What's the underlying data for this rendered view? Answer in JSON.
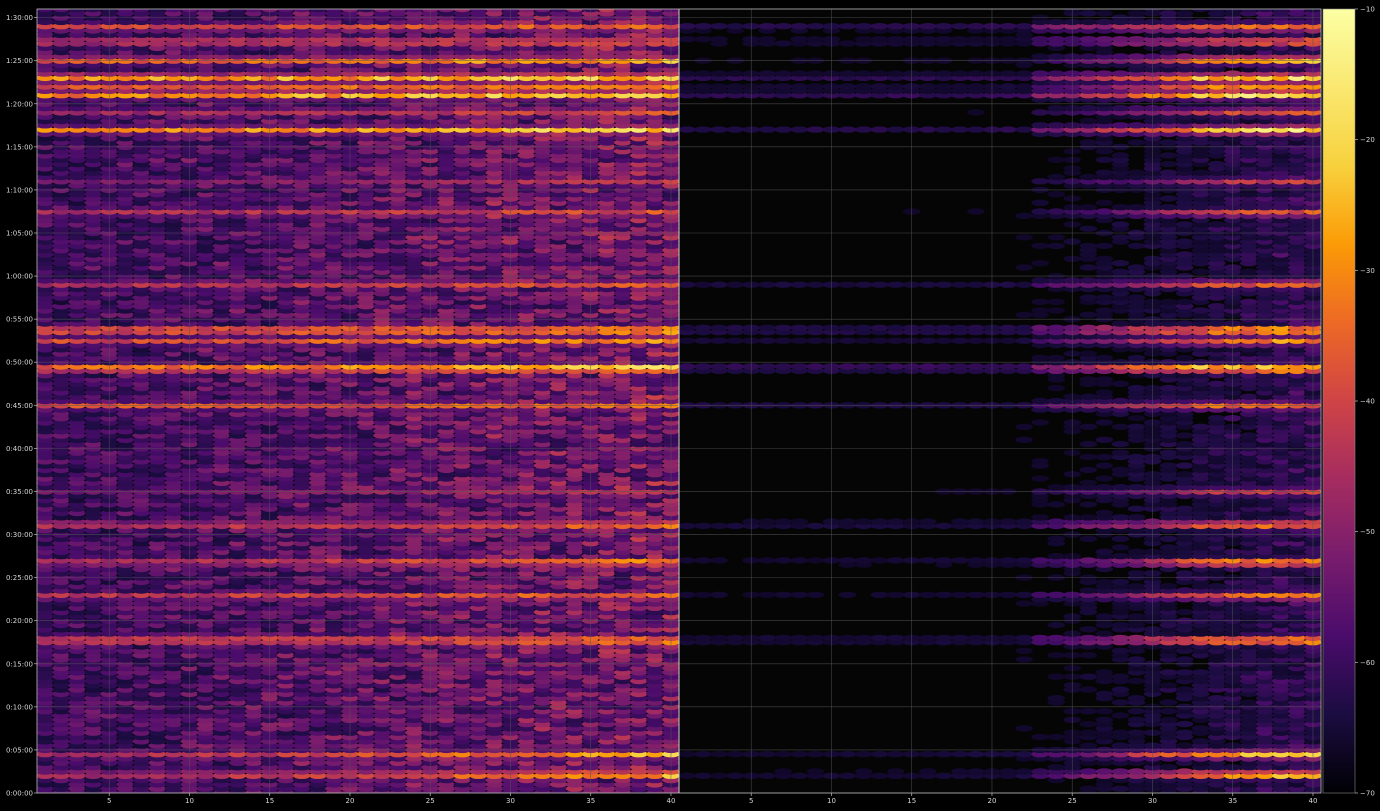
{
  "chart_data": {
    "type": "heatmap",
    "title": "",
    "xlabel": "",
    "ylabel": "",
    "grid": true,
    "colormap": "inferno",
    "background": "#000000",
    "grid_color": "#444444",
    "panels": [
      {
        "name": "",
        "xlim": [
          1,
          40
        ],
        "x_ticks": [
          5,
          10,
          15,
          20,
          25,
          30,
          35,
          40
        ],
        "x_tick_labels": [
          "5",
          "10",
          "15",
          "20",
          "25",
          "30",
          "35",
          "40"
        ]
      },
      {
        "name": "",
        "xlim": [
          1,
          40
        ],
        "x_ticks": [
          5,
          10,
          15,
          20,
          25,
          30,
          35,
          40
        ],
        "x_tick_labels": [
          "5",
          "10",
          "15",
          "20",
          "25",
          "30",
          "35",
          "40"
        ]
      }
    ],
    "y_range_seconds": [
      0,
      5460
    ],
    "y_ticks_seconds": [
      0,
      300,
      600,
      900,
      1200,
      1500,
      1800,
      2100,
      2400,
      2700,
      3000,
      3300,
      3600,
      3900,
      4200,
      4500,
      4800,
      5100,
      5400
    ],
    "y_tick_labels": [
      "0:00:00",
      "0:05:00",
      "0:10:00",
      "0:15:00",
      "0:20:00",
      "0:25:00",
      "0:30:00",
      "0:35:00",
      "0:40:00",
      "0:45:00",
      "0:50:00",
      "0:55:00",
      "1:00:00",
      "1:05:00",
      "1:10:00",
      "1:15:00",
      "1:20:00",
      "1:25:00",
      "1:30:00"
    ],
    "colorbar": {
      "range": [
        -70,
        -10
      ],
      "ticks": [
        -70,
        -60,
        -50,
        -40,
        -30,
        -20,
        -10
      ],
      "tick_labels": [
        "−70",
        "−60",
        "−50",
        "−40",
        "−30",
        "−20",
        "−10"
      ]
    },
    "bands": [
      {
        "t": 5335,
        "level": [
          0.5,
          0.62
        ],
        "span": [
          1,
          40
        ],
        "p2": 0.35
      },
      {
        "t": 5235,
        "level": [
          0.48,
          0.62
        ],
        "span": [
          1,
          40
        ],
        "p2": 0.25
      },
      {
        "t": 5105,
        "level": [
          0.58,
          0.78
        ],
        "span": [
          1,
          40
        ],
        "p2": 0.15
      },
      {
        "t": 4985,
        "level": [
          0.7,
          0.86
        ],
        "span": [
          1,
          40
        ],
        "p2": 0.28
      },
      {
        "t": 4925,
        "level": [
          0.55,
          0.76
        ],
        "span": [
          1,
          40
        ],
        "p2": 0.2
      },
      {
        "t": 4865,
        "level": [
          0.68,
          0.9
        ],
        "span": [
          1,
          40
        ],
        "p2": 0.3
      },
      {
        "t": 4745,
        "level": [
          0.4,
          0.56
        ],
        "span": [
          1,
          40
        ],
        "p2": 0.18
      },
      {
        "t": 4620,
        "level": [
          0.64,
          0.88
        ],
        "span": [
          1,
          40
        ],
        "p2": 0.26
      },
      {
        "t": 4260,
        "level": [
          0.3,
          0.48
        ],
        "span": [
          1,
          40
        ],
        "p2": 0.2
      },
      {
        "t": 4045,
        "level": [
          0.42,
          0.56
        ],
        "span": [
          1,
          40
        ],
        "p2": 0.18
      },
      {
        "t": 3545,
        "level": [
          0.44,
          0.58
        ],
        "span": [
          1,
          40
        ],
        "p2": 0.3
      },
      {
        "t": 3225,
        "level": [
          0.62,
          0.82
        ],
        "span": [
          1,
          40
        ],
        "p2": 0.3
      },
      {
        "t": 3150,
        "level": [
          0.52,
          0.7
        ],
        "span": [
          1,
          40
        ],
        "p2": 0.22
      },
      {
        "t": 2960,
        "level": [
          0.66,
          0.9
        ],
        "span": [
          1,
          40
        ],
        "p2": 0.35
      },
      {
        "t": 2700,
        "level": [
          0.54,
          0.62
        ],
        "span": [
          1,
          40
        ],
        "p2": 0.28
      },
      {
        "t": 2100,
        "level": [
          0.28,
          0.5
        ],
        "span": [
          1,
          40
        ],
        "p2": 0.26
      },
      {
        "t": 1870,
        "level": [
          0.46,
          0.66
        ],
        "span": [
          1,
          40
        ],
        "p2": 0.3
      },
      {
        "t": 1610,
        "level": [
          0.44,
          0.74
        ],
        "span": [
          1,
          40
        ],
        "p2": 0.25
      },
      {
        "t": 1375,
        "level": [
          0.46,
          0.64
        ],
        "span": [
          1,
          40
        ],
        "p2": 0.22
      },
      {
        "t": 1065,
        "level": [
          0.54,
          0.76
        ],
        "span": [
          1,
          40
        ],
        "p2": 0.26
      },
      {
        "t": 270,
        "level": [
          0.4,
          0.8
        ],
        "span": [
          1,
          40
        ],
        "p2": 0.26
      },
      {
        "t": 130,
        "level": [
          0.44,
          0.82
        ],
        "span": [
          1,
          40
        ],
        "p2": 0.26
      }
    ]
  }
}
